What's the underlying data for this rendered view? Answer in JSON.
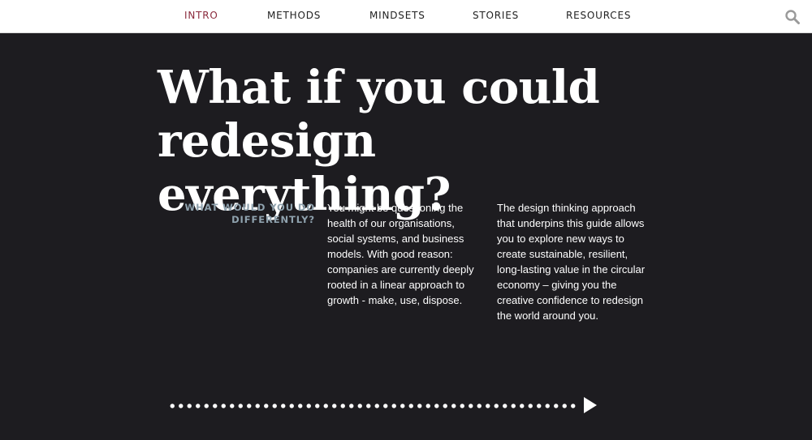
{
  "nav": {
    "items": [
      {
        "label": "INTRO",
        "active": true
      },
      {
        "label": "METHODS",
        "active": false
      },
      {
        "label": "MINDSETS",
        "active": false
      },
      {
        "label": "STORIES",
        "active": false
      },
      {
        "label": "RESOURCES",
        "active": false
      }
    ],
    "active_color": "#8a2a3c",
    "search_icon": "search-icon"
  },
  "hero": {
    "title_line1": "What if you could",
    "title_line2": "redesign everything?",
    "subheading_line1": "WHAT WOULD YOU DO",
    "subheading_line2": "DIFFERENTLY?",
    "paragraph_1": "You might be questioning the health of our organisations, social systems, and business models. With good reason: companies are currently deeply rooted in a linear approach to growth - make, use, dispose.",
    "paragraph_2": "The design thinking approach that underpins this guide allows you to explore new ways to create sustainable, resilient, long-lasting value in the circular economy – giving you the creative confidence to redesign the world around you.",
    "background_color": "#1d1c20",
    "subheading_color": "#8fa2ae"
  },
  "progress": {
    "icon": "play-icon"
  }
}
